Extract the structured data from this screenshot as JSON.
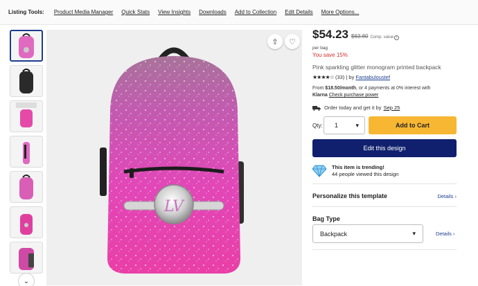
{
  "toolbar": {
    "label": "Listing Tools:",
    "links": [
      "Product Media Manager",
      "Quick Stats",
      "View Insights",
      "Downloads",
      "Add to Collection",
      "Edit Details",
      "More Options..."
    ]
  },
  "gallery": {
    "thumbnail_count": 7,
    "active_index": 0
  },
  "product": {
    "price": "$54.23",
    "compare_price": "$63.80",
    "compare_label": "Comp. value",
    "per_unit": "per bag",
    "savings": "You save 15%",
    "title": "Pink sparkling glitter monogram printed backpack",
    "rating_stars": "★★★★☆",
    "rating_value": 4,
    "review_count": "(33)",
    "by_prefix": "| by",
    "seller": "Fantabuloustef",
    "monogram": "LV"
  },
  "financing": {
    "prefix": "From",
    "amount": "$18.50/month",
    "suffix": ", or 4 payments at 0% interest with",
    "provider": "Klarna",
    "link": "Check purchase power"
  },
  "delivery": {
    "text": "Order today and get it by",
    "date": "Sep 25"
  },
  "purchase": {
    "qty_label": "Qty:",
    "qty_value": "1",
    "add_to_cart": "Add to Cart",
    "edit_design": "Edit this design"
  },
  "trending": {
    "title": "This item is trending!",
    "subtitle": "44 people viewed this design"
  },
  "personalize": {
    "title": "Personalize this template",
    "link": "Details"
  },
  "bag_type": {
    "title": "Bag Type",
    "selected": "Backpack",
    "link": "Details"
  },
  "colors": {
    "cart_button": "#f7b733",
    "edit_button": "#10206e",
    "savings": "#d32f2f",
    "link": "#1a3d8f",
    "glitter_pink": "#e83fae"
  }
}
